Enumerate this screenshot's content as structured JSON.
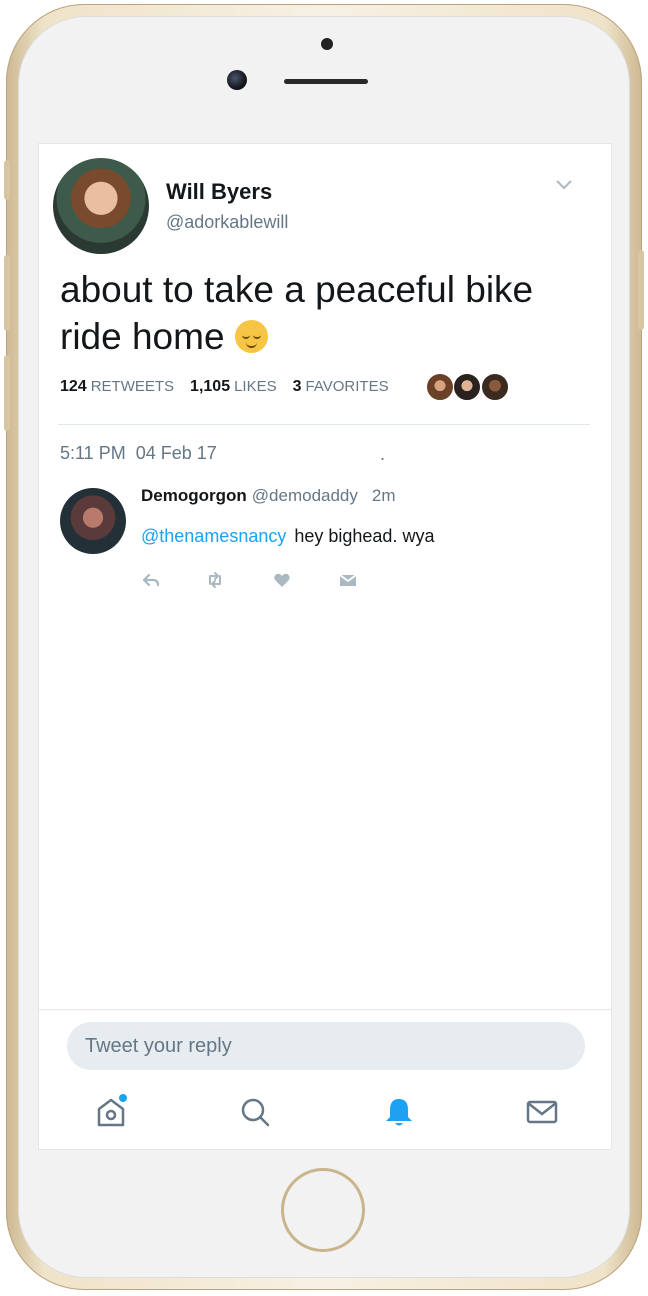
{
  "tweet": {
    "author_name": "Will Byers",
    "author_handle": "@adorkablewill",
    "text": "about to take a peaceful bike ride home",
    "retweets": "124",
    "retweets_label": "RETWEETS",
    "likes": "1,105",
    "likes_label": "LIKES",
    "favorites": "3",
    "favorites_label": "FAVORITES",
    "timestamp": "5:11 PM  04 Feb 17",
    "dot": "."
  },
  "reply": {
    "author_name": "Demogorgon",
    "author_handle": "@demodaddy",
    "time_ago": "2m",
    "mention": "@thenamesnancy",
    "text": "hey bighead. wya"
  },
  "composer": {
    "placeholder": "Tweet your reply"
  },
  "colors": {
    "accent": "#1da1f2",
    "muted_text": "#657786",
    "primary_text": "#14171a"
  },
  "icons": {
    "reply": "reply-icon",
    "retweet": "retweet-icon",
    "like": "heart-icon",
    "dm": "dm-icon",
    "home": "home-icon",
    "search": "search-icon",
    "notifications": "bell-icon",
    "messages": "mail-icon",
    "more": "chevron-down-icon",
    "emoji": "relieved-face-emoji"
  }
}
